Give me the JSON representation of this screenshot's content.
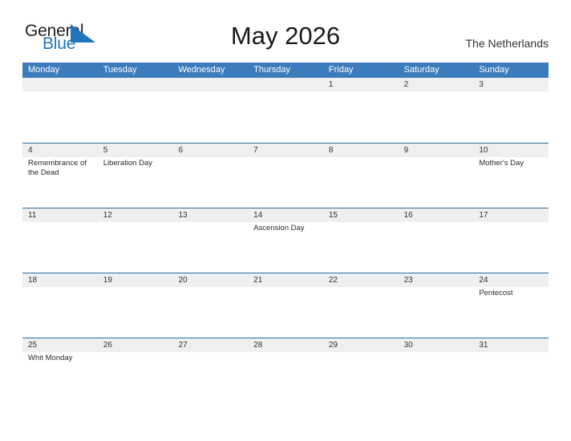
{
  "brand": {
    "name_part1": "General",
    "name_part2": "Blue",
    "flag_icon": "flag-triangle-icon",
    "color_primary": "#1f76bc",
    "color_text": "#231f20"
  },
  "header": {
    "title": "May 2026",
    "region": "The Netherlands"
  },
  "theme": {
    "header_blue": "#3c7cbd",
    "row_border_blue": "#2e6da4",
    "date_band_gray": "#efefef",
    "page_background": "#ffffff"
  },
  "calendar": {
    "weekdays": [
      "Monday",
      "Tuesday",
      "Wednesday",
      "Thursday",
      "Friday",
      "Saturday",
      "Sunday"
    ],
    "weeks": [
      {
        "days": [
          {
            "number": "",
            "events": []
          },
          {
            "number": "",
            "events": []
          },
          {
            "number": "",
            "events": []
          },
          {
            "number": "",
            "events": []
          },
          {
            "number": "1",
            "events": []
          },
          {
            "number": "2",
            "events": []
          },
          {
            "number": "3",
            "events": []
          }
        ]
      },
      {
        "days": [
          {
            "number": "4",
            "events": [
              "Remembrance of the Dead"
            ]
          },
          {
            "number": "5",
            "events": [
              "Liberation Day"
            ]
          },
          {
            "number": "6",
            "events": []
          },
          {
            "number": "7",
            "events": []
          },
          {
            "number": "8",
            "events": []
          },
          {
            "number": "9",
            "events": []
          },
          {
            "number": "10",
            "events": [
              "Mother's Day"
            ]
          }
        ]
      },
      {
        "days": [
          {
            "number": "11",
            "events": []
          },
          {
            "number": "12",
            "events": []
          },
          {
            "number": "13",
            "events": []
          },
          {
            "number": "14",
            "events": [
              "Ascension Day"
            ]
          },
          {
            "number": "15",
            "events": []
          },
          {
            "number": "16",
            "events": []
          },
          {
            "number": "17",
            "events": []
          }
        ]
      },
      {
        "days": [
          {
            "number": "18",
            "events": []
          },
          {
            "number": "19",
            "events": []
          },
          {
            "number": "20",
            "events": []
          },
          {
            "number": "21",
            "events": []
          },
          {
            "number": "22",
            "events": []
          },
          {
            "number": "23",
            "events": []
          },
          {
            "number": "24",
            "events": [
              "Pentecost"
            ]
          }
        ]
      },
      {
        "days": [
          {
            "number": "25",
            "events": [
              "Whit Monday"
            ]
          },
          {
            "number": "26",
            "events": []
          },
          {
            "number": "27",
            "events": []
          },
          {
            "number": "28",
            "events": []
          },
          {
            "number": "29",
            "events": []
          },
          {
            "number": "30",
            "events": []
          },
          {
            "number": "31",
            "events": []
          }
        ]
      }
    ]
  }
}
